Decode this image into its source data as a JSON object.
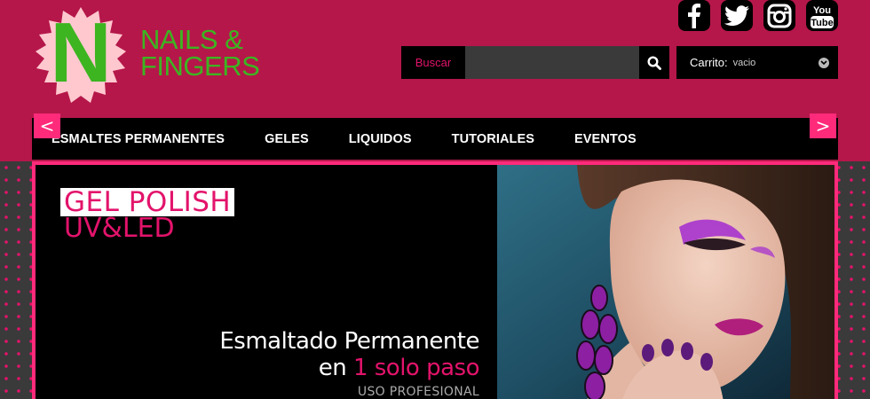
{
  "brand": {
    "letter": "N",
    "line1": "NAILS &",
    "line2": "FINGERS",
    "accent": "#3cb521",
    "badge_color": "#ffc8cf"
  },
  "social": [
    {
      "icon": "facebook-icon",
      "glyph": "f"
    },
    {
      "icon": "twitter-icon",
      "glyph": "t"
    },
    {
      "icon": "instagram-icon",
      "glyph": "o"
    },
    {
      "icon": "youtube-icon",
      "glyph": "You Tube"
    }
  ],
  "search": {
    "label": "Buscar",
    "value": "",
    "icon": "search-icon"
  },
  "cart": {
    "label": "Carrito:",
    "value": "vacio",
    "icon": "chevron-down-icon"
  },
  "nav": {
    "items": [
      {
        "label": "ESMALTES PERMANENTES"
      },
      {
        "label": "GELES"
      },
      {
        "label": "LIQUIDOS"
      },
      {
        "label": "TUTORIALES"
      },
      {
        "label": "EVENTOS"
      }
    ]
  },
  "banner": {
    "badge_line1": "GEL POLISH",
    "badge_line2": "UV&LED",
    "tagline1": "Esmaltado Permanente",
    "tagline2_prefix": "en ",
    "tagline2_highlight": "1 solo paso",
    "tagline3": "USO PROFESIONAL",
    "prev": "<",
    "next": ">"
  },
  "colors": {
    "header_bg": "#b5174a",
    "accent_pink": "#e3136b",
    "border_pink": "#ff2a7a",
    "nav_bg": "#000000"
  }
}
